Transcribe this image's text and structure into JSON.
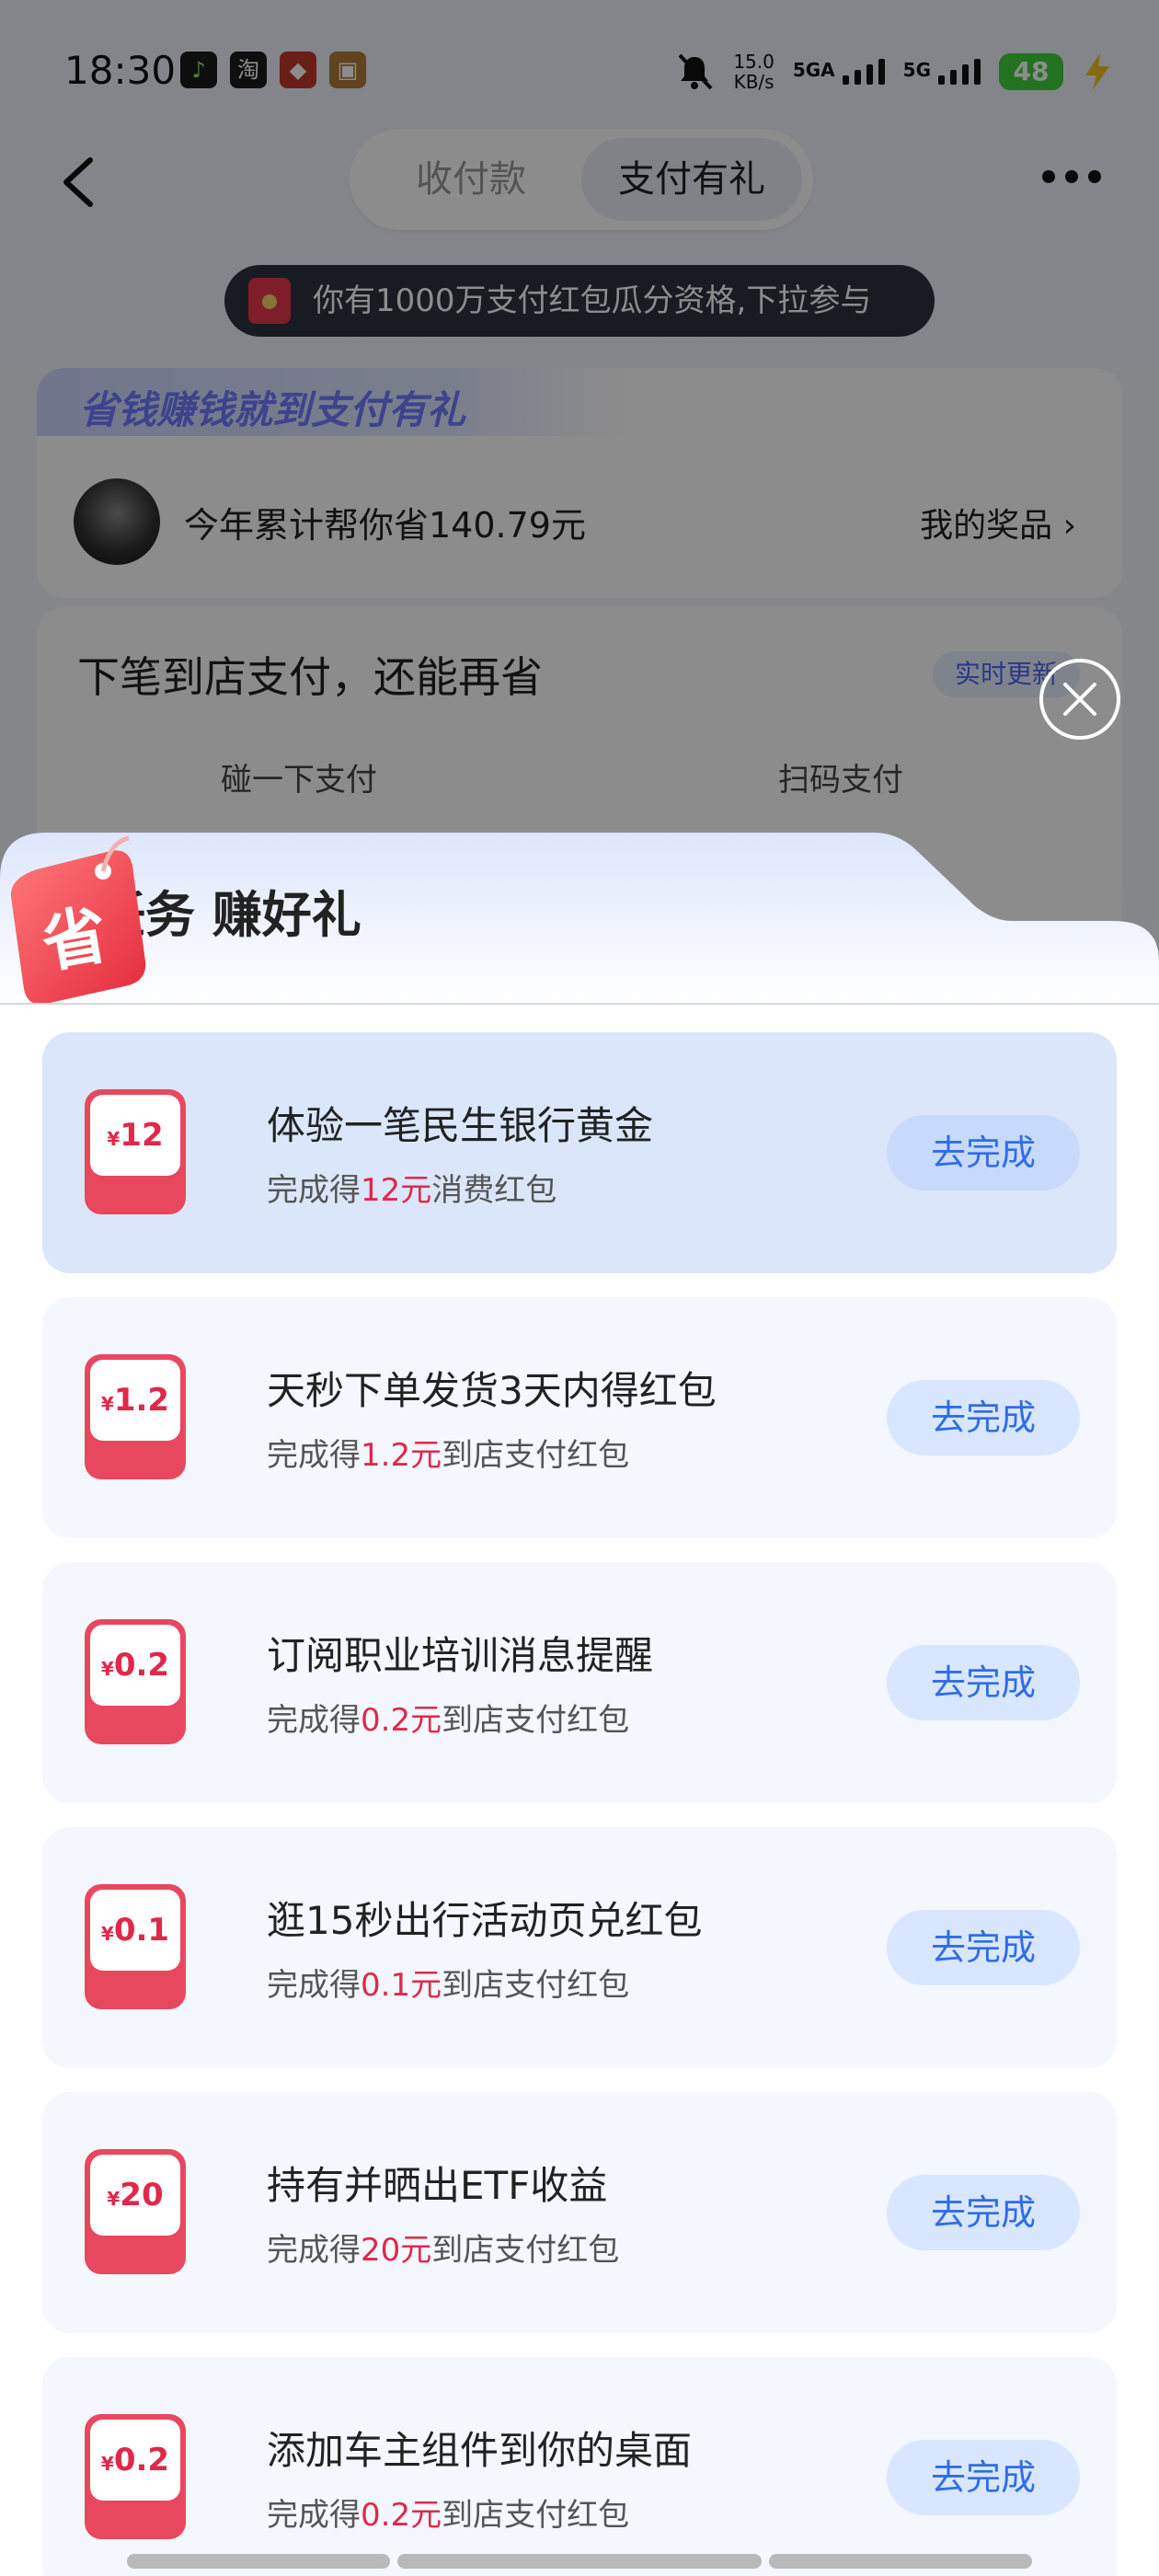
{
  "status_bar": {
    "time": "18:30",
    "app_icons": [
      {
        "name": "music-app-icon",
        "color": "#1a1a1a",
        "glyph": "♪"
      },
      {
        "name": "taobao-app-icon",
        "color": "#1a1a1a",
        "glyph": "淘"
      },
      {
        "name": "game-app-icon",
        "color": "#c0392b",
        "glyph": "◆"
      },
      {
        "name": "wallet-app-icon",
        "color": "#b07a3a",
        "glyph": "▣"
      }
    ],
    "net_speed": "15.0",
    "net_unit": "KB/s",
    "sim1": "5GA",
    "sim2": "5G",
    "battery": "48"
  },
  "nav": {
    "tab_pay": "收付款",
    "tab_gift": "支付有礼"
  },
  "notice": "你有1000万支付红包瓜分资格,下拉参与",
  "summary": {
    "slogan": "省钱赚钱就到支付有礼",
    "saved_text": "今年累计帮你省140.79元",
    "prize_link": "我的奖品 ›"
  },
  "next_pay": {
    "title": "下笔到店支付，还能再省",
    "realtime": "实时更新",
    "method_a": "碰一下支付",
    "method_b": "扫码支付"
  },
  "sheet": {
    "title": "做任务 赚好礼",
    "badge": "省",
    "tasks": [
      {
        "amount": "12",
        "title": "体验一笔民生银行黄金",
        "sub_pre": "完成得",
        "sub_amt": "12元",
        "sub_post": "消费红包",
        "button": "去完成"
      },
      {
        "amount": "1.2",
        "title": "天秒下单发货3天内得红包",
        "sub_pre": "完成得",
        "sub_amt": "1.2元",
        "sub_post": "到店支付红包",
        "button": "去完成"
      },
      {
        "amount": "0.2",
        "title": "订阅职业培训消息提醒",
        "sub_pre": "完成得",
        "sub_amt": "0.2元",
        "sub_post": "到店支付红包",
        "button": "去完成"
      },
      {
        "amount": "0.1",
        "title": "逛15秒出行活动页兑红包",
        "sub_pre": "完成得",
        "sub_amt": "0.1元",
        "sub_post": "到店支付红包",
        "button": "去完成"
      },
      {
        "amount": "20",
        "title": "持有并晒出ETF收益",
        "sub_pre": "完成得",
        "sub_amt": "20元",
        "sub_post": "到店支付红包",
        "button": "去完成"
      },
      {
        "amount": "0.2",
        "title": "添加车主组件到你的桌面",
        "sub_pre": "完成得",
        "sub_amt": "0.2元",
        "sub_post": "到店支付红包",
        "button": "去完成"
      }
    ],
    "currency": "¥"
  },
  "colors": {
    "accent_blue": "#2f6de8",
    "coupon_red": "#e8485e",
    "amount_red": "#e0284a",
    "highlight_bg": "#dbe6fb"
  }
}
